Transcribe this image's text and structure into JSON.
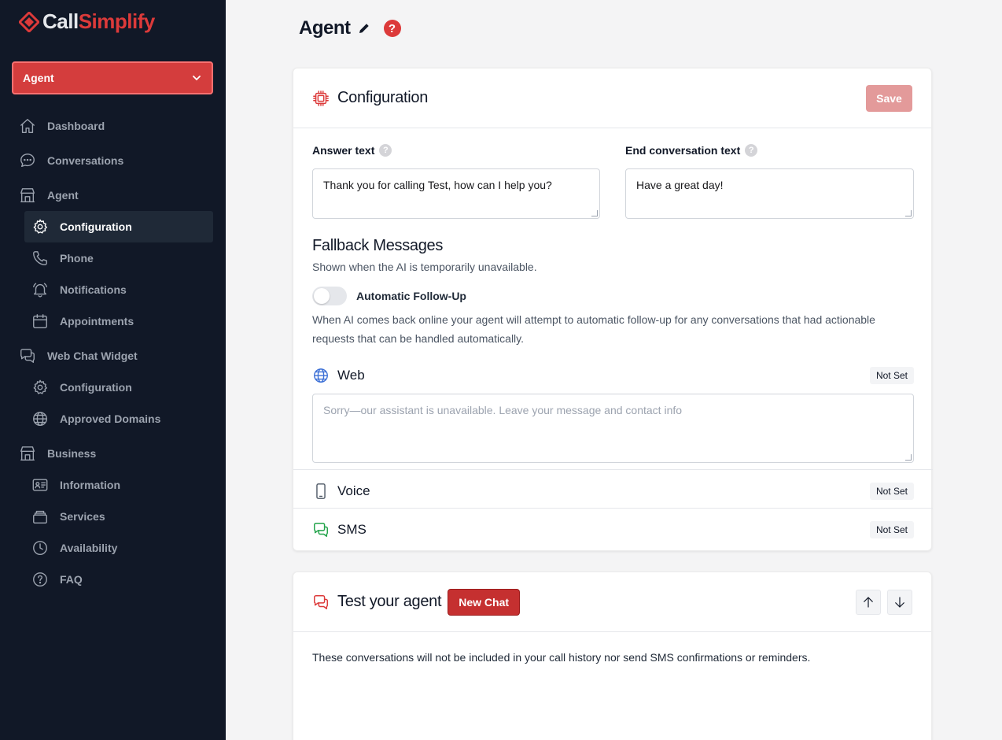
{
  "brand": {
    "name_part1": "Call",
    "name_part2": "Simplify",
    "accent": "#dc3a3a"
  },
  "agent_select": {
    "value": "Agent"
  },
  "sidebar": {
    "items": [
      {
        "label": "Dashboard",
        "icon": "home-icon"
      },
      {
        "label": "Conversations",
        "icon": "chat-bubble-icon"
      },
      {
        "label": "Agent",
        "icon": "building-icon"
      },
      {
        "label": "Configuration",
        "icon": "gear-icon",
        "active": true
      },
      {
        "label": "Phone",
        "icon": "phone-icon"
      },
      {
        "label": "Notifications",
        "icon": "bell-icon"
      },
      {
        "label": "Appointments",
        "icon": "calendar-icon"
      },
      {
        "label": "Web Chat Widget",
        "icon": "chat-bubbles-icon"
      },
      {
        "label": "Configuration",
        "icon": "gear-icon"
      },
      {
        "label": "Approved Domains",
        "icon": "globe-icon"
      },
      {
        "label": "Business",
        "icon": "building-icon"
      },
      {
        "label": "Information",
        "icon": "id-card-icon"
      },
      {
        "label": "Services",
        "icon": "stack-icon"
      },
      {
        "label": "Availability",
        "icon": "clock-icon"
      },
      {
        "label": "FAQ",
        "icon": "question-circle-icon"
      }
    ]
  },
  "page": {
    "title": "Agent",
    "help": "?"
  },
  "config_card": {
    "title": "Configuration",
    "save_label": "Save",
    "answer_label": "Answer text",
    "answer_value": "Thank you for calling Test, how can I help you?",
    "end_label": "End conversation text",
    "end_value": "Have a great day!",
    "fallback_title": "Fallback Messages",
    "fallback_desc": "Shown when the AI is temporarily unavailable.",
    "followup_label": "Automatic Follow-Up",
    "followup_enabled": false,
    "followup_desc_line1": "When AI comes back online your agent will attempt to automatic follow-up for any conversations that had actionable",
    "followup_desc_line2": "requests that can be handled automatically.",
    "channels": {
      "web": {
        "name": "Web",
        "status": "Not Set",
        "placeholder": "Sorry—our assistant is unavailable. Leave your message and contact info"
      },
      "voice": {
        "name": "Voice",
        "status": "Not Set"
      },
      "sms": {
        "name": "SMS",
        "status": "Not Set"
      }
    }
  },
  "test_card": {
    "title": "Test your agent",
    "new_chat_label": "New Chat",
    "note": "These conversations will not be included in your call history nor send SMS confirmations or reminders."
  }
}
